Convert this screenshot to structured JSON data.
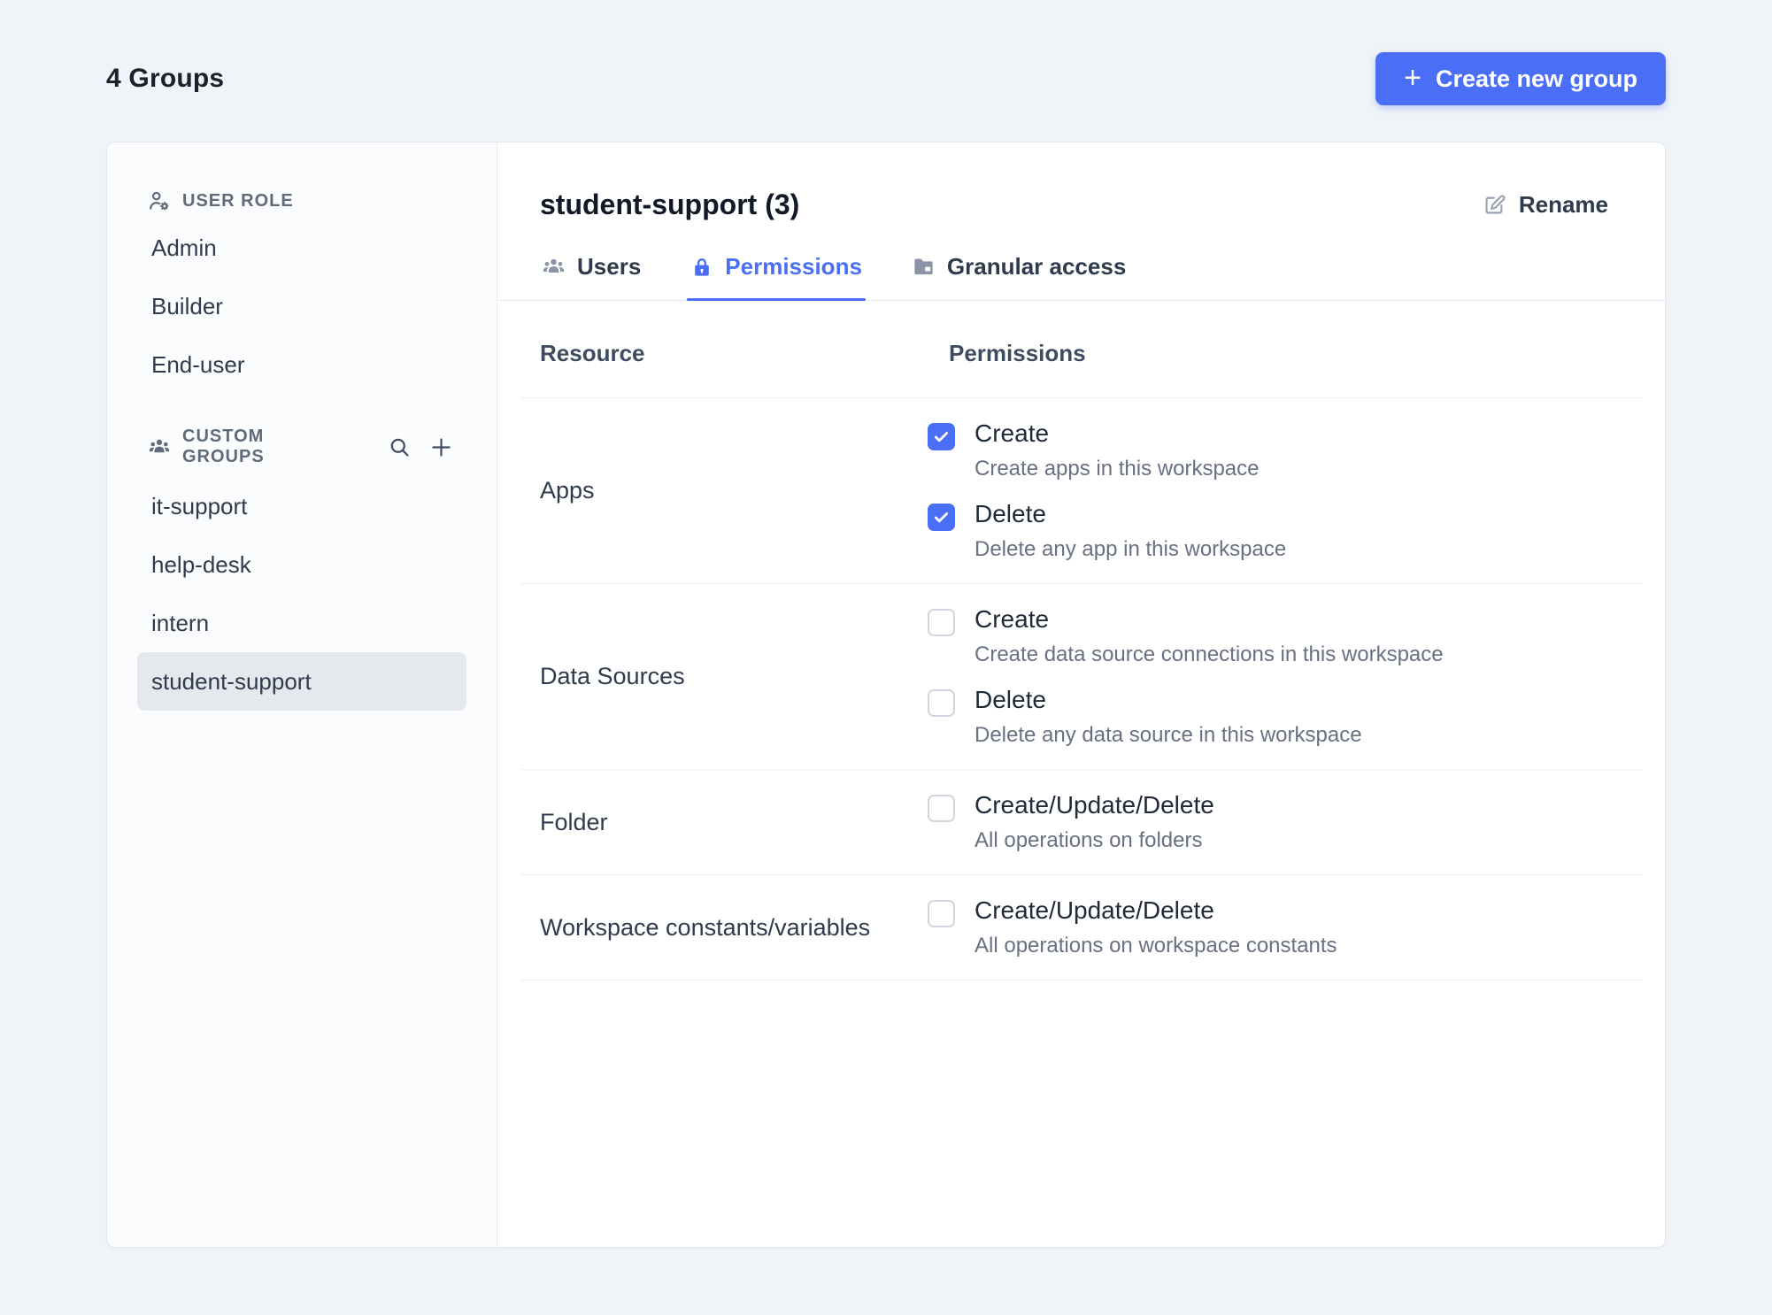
{
  "page": {
    "title": "4 Groups",
    "create_group_label": "Create new group"
  },
  "sidebar": {
    "user_role": {
      "header": "USER ROLE",
      "items": [
        "Admin",
        "Builder",
        "End-user"
      ]
    },
    "custom_groups": {
      "header": "CUSTOM GROUPS",
      "items": [
        "it-support",
        "help-desk",
        "intern",
        "student-support"
      ],
      "selected": "student-support",
      "icons": [
        "search-icon",
        "plus-icon"
      ]
    }
  },
  "main": {
    "title": "student-support (3)",
    "rename_label": "Rename",
    "tabs": [
      {
        "label": "Users",
        "icon": "users-icon",
        "active": false
      },
      {
        "label": "Permissions",
        "icon": "lock-icon",
        "active": true
      },
      {
        "label": "Granular access",
        "icon": "folder-icon",
        "active": false
      }
    ],
    "table": {
      "columns": [
        "Resource",
        "Permissions"
      ],
      "rows": [
        {
          "resource": "Apps",
          "permissions": [
            {
              "label": "Create",
              "description": "Create apps in this workspace",
              "checked": true
            },
            {
              "label": "Delete",
              "description": "Delete any app in this workspace",
              "checked": true
            }
          ]
        },
        {
          "resource": "Data Sources",
          "permissions": [
            {
              "label": "Create",
              "description": "Create data source connections in this workspace",
              "checked": false
            },
            {
              "label": "Delete",
              "description": "Delete any data source in this workspace",
              "checked": false
            }
          ]
        },
        {
          "resource": "Folder",
          "permissions": [
            {
              "label": "Create/Update/Delete",
              "description": "All operations on folders",
              "checked": false
            }
          ]
        },
        {
          "resource": "Workspace constants/variables",
          "permissions": [
            {
              "label": "Create/Update/Delete",
              "description": "All operations on workspace constants",
              "checked": false
            }
          ]
        }
      ]
    }
  },
  "colors": {
    "accent": "#4a6ef5",
    "page_bg": "#f0f4f8",
    "selected_item_bg": "#e5e8ed"
  }
}
